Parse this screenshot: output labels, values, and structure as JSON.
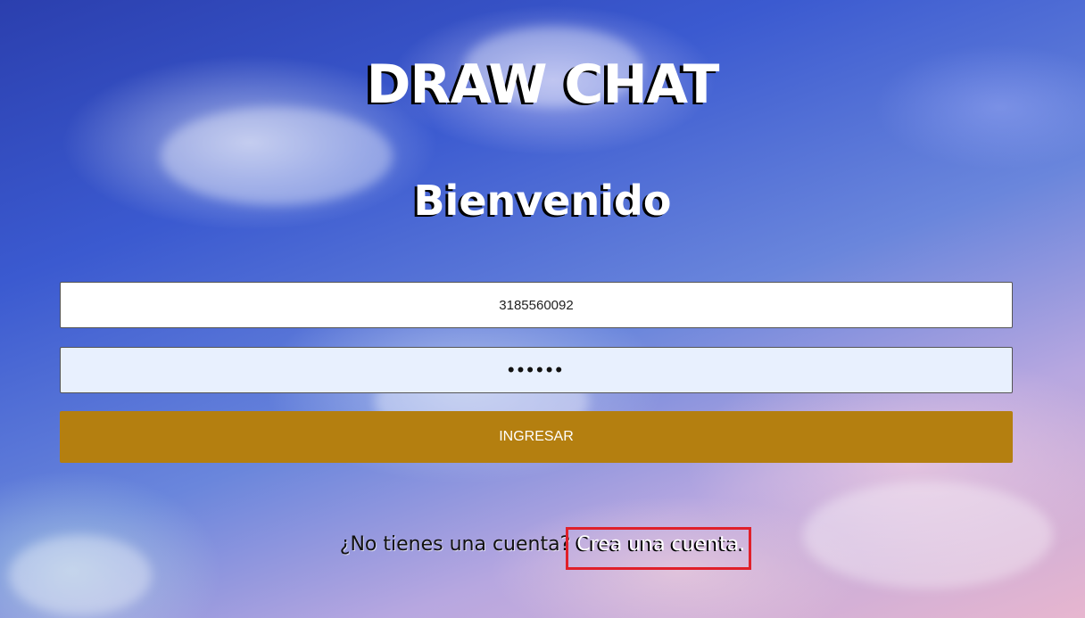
{
  "app": {
    "title": "DRAW CHAT",
    "subtitle": "Bienvenido"
  },
  "form": {
    "phone_value": "3185560092",
    "password_value": "••••••",
    "login_label": "INGRESAR"
  },
  "signup": {
    "prompt": "¿No tienes una cuenta?",
    "link_label": "Crea una cuenta."
  },
  "colors": {
    "button": "#b47f10",
    "highlight": "#e0202a",
    "password_field": "#e8f0fe"
  }
}
